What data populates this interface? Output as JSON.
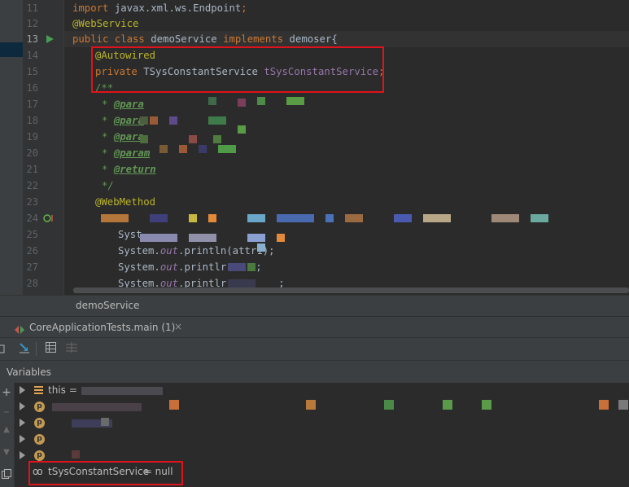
{
  "editor": {
    "line_numbers": [
      "11",
      "12",
      "13",
      "14",
      "15",
      "16",
      "17",
      "18",
      "19",
      "20",
      "21",
      "22",
      "23",
      "24",
      "25",
      "26",
      "27",
      "28"
    ],
    "current_line": "13",
    "lines": {
      "l11": {
        "kw": "import",
        "text": " javax.xml.ws.Endpoint",
        "semi": ";"
      },
      "l12": {
        "ann": "@WebService"
      },
      "l13": {
        "kw1": "public class",
        "name": " demoService ",
        "kw2": "implements",
        "rest": " demoser{"
      },
      "l14": {
        "ann": "@Autowired"
      },
      "l15": {
        "kw": "private",
        "type": " TSysConstantService ",
        "field": "tSysConstantService",
        "semi": ";"
      },
      "l16": {
        "cmt": "/**"
      },
      "l17": {
        "star": "* ",
        "tag": "@para"
      },
      "l18": {
        "star": "* ",
        "tag": "@para"
      },
      "l19": {
        "star": "* ",
        "tag": "@para"
      },
      "l20": {
        "star": "* ",
        "tag": "@param"
      },
      "l21": {
        "star": "* ",
        "tag": "@return"
      },
      "l22": {
        "cmt": "*/"
      },
      "l23": {
        "ann": "@WebMethod"
      },
      "l25": {
        "text": "Syst"
      },
      "l26": {
        "pre": "System.",
        "stat": "out",
        "post": ".println(attr1);"
      },
      "l27": {
        "pre": "System.",
        "stat": "out",
        "post": ".printlr",
        "semi": ";"
      },
      "l28": {
        "pre": "System.",
        "stat": "out",
        "post": ".printlr",
        "semi": ";"
      }
    }
  },
  "breadcrumb": {
    "label": "demoService"
  },
  "debug": {
    "tab_label": "CoreApplicationTests.main (1)",
    "tab_close": "×",
    "variables_header": "Variables",
    "this_label": "this",
    "this_eq": " =",
    "watch_name": "tSysConstantService",
    "watch_value": " = null",
    "badge_letter": "p"
  },
  "colors": {
    "highlight_box": "#e0121b",
    "keyword": "#cc7832",
    "annotation": "#bbb529",
    "comment": "#629755",
    "field": "#9876aa"
  },
  "icons": {
    "run": "run-gutter-icon",
    "override": "override-gutter-icon",
    "watch": "glasses-icon"
  }
}
